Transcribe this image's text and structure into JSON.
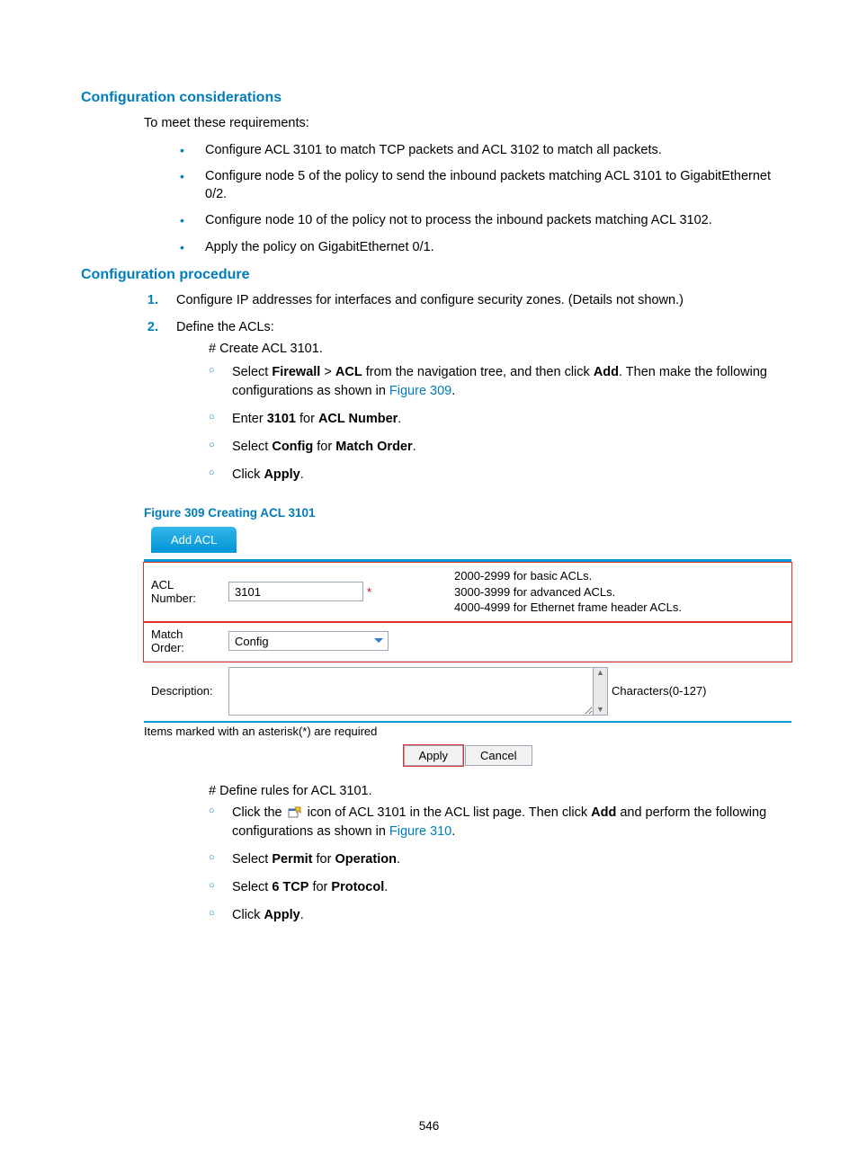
{
  "page_number": "546",
  "sec_considerations": {
    "title": "Configuration considerations",
    "intro": "To meet these requirements:",
    "bullets": [
      "Configure ACL 3101 to match TCP packets and ACL 3102 to match all packets.",
      "Configure node 5 of the policy to send the inbound packets matching ACL 3101 to GigabitEthernet 0/2.",
      "Configure node 10 of the policy not to process the inbound packets matching ACL 3102.",
      "Apply the policy on GigabitEthernet 0/1."
    ]
  },
  "sec_procedure": {
    "title": "Configuration procedure",
    "step1": {
      "num": "1.",
      "text": "Configure IP addresses for interfaces and configure security zones. (Details not shown.)"
    },
    "step2": {
      "num": "2.",
      "text": "Define the ACLs:",
      "sub_a_title": "# Create ACL 3101.",
      "sub_a_items": {
        "i1_pre": "Select ",
        "i1_b1": "Firewall",
        "i1_gt": " > ",
        "i1_b2": "ACL",
        "i1_mid": " from the navigation tree, and then click ",
        "i1_b3": "Add",
        "i1_post": ". Then make the following configurations as shown in ",
        "i1_link": "Figure 309",
        "i1_dot": ".",
        "i2_pre": "Enter ",
        "i2_b1": "3101",
        "i2_mid": " for ",
        "i2_b2": "ACL Number",
        "i2_dot": ".",
        "i3_pre": "Select ",
        "i3_b1": "Config",
        "i3_mid": " for ",
        "i3_b2": "Match Order",
        "i3_dot": ".",
        "i4_pre": "Click ",
        "i4_b1": "Apply",
        "i4_dot": "."
      },
      "figure_caption": "Figure 309 Creating ACL 3101",
      "sub_b_title": "# Define rules for ACL 3101.",
      "sub_b_items": {
        "j1_pre": "Click the ",
        "j1_mid": " icon of ACL 3101 in the ACL list page. Then click ",
        "j1_b1": "Add",
        "j1_post": " and perform the following configurations as shown in ",
        "j1_link": "Figure 310",
        "j1_dot": ".",
        "j2_pre": "Select ",
        "j2_b1": "Permit",
        "j2_mid": " for ",
        "j2_b2": "Operation",
        "j2_dot": ".",
        "j3_pre": "Select ",
        "j3_b1": "6 TCP",
        "j3_mid": " for ",
        "j3_b2": "Protocol",
        "j3_dot": ".",
        "j4_pre": "Click ",
        "j4_b1": "Apply",
        "j4_dot": "."
      }
    }
  },
  "figure": {
    "tab": "Add ACL",
    "acl_label_a": "ACL",
    "acl_label_b": "Number:",
    "acl_value": "3101",
    "asterisk": "*",
    "hint1": "2000-2999 for basic ACLs.",
    "hint2": "3000-3999 for advanced ACLs.",
    "hint3": "4000-4999 for Ethernet frame header ACLs.",
    "match_label_a": "Match",
    "match_label_b": "Order:",
    "match_value": "Config",
    "desc_label": "Description:",
    "desc_hint": "Characters(0-127)",
    "req_note": "Items marked with an asterisk(*) are required",
    "apply": "Apply",
    "cancel": "Cancel"
  }
}
